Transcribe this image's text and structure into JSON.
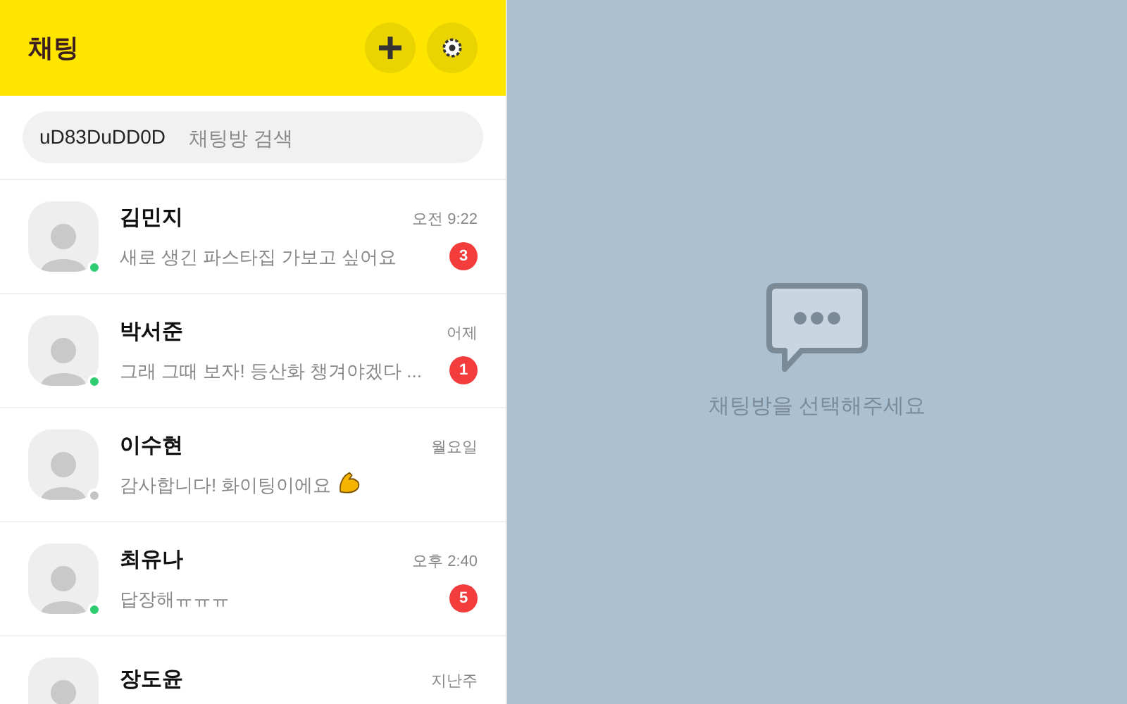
{
  "header": {
    "title": "채팅"
  },
  "search": {
    "icon_text": "uD83DuDD0D",
    "placeholder": "채팅방 검색"
  },
  "chats": [
    {
      "name": "김민지",
      "time": "오전 9:22",
      "message": "새로 생긴 파스타집 가보고 싶어요",
      "unread": "3",
      "online": true
    },
    {
      "name": "박서준",
      "time": "어제",
      "message": "그래 그때 보자! 등산화 챙겨야겠다 ...",
      "unread": "1",
      "online": true
    },
    {
      "name": "이수현",
      "time": "월요일",
      "message": "감사합니다! 화이팅이에요",
      "has_emoji": true,
      "online": false
    },
    {
      "name": "최유나",
      "time": "오후 2:40",
      "message": "답장해ㅠㅠㅠ",
      "unread": "5",
      "online": true
    },
    {
      "name": "장도윤",
      "time": "지난주"
    }
  ],
  "empty_state": {
    "text": "채팅방을 선택해주세요"
  }
}
